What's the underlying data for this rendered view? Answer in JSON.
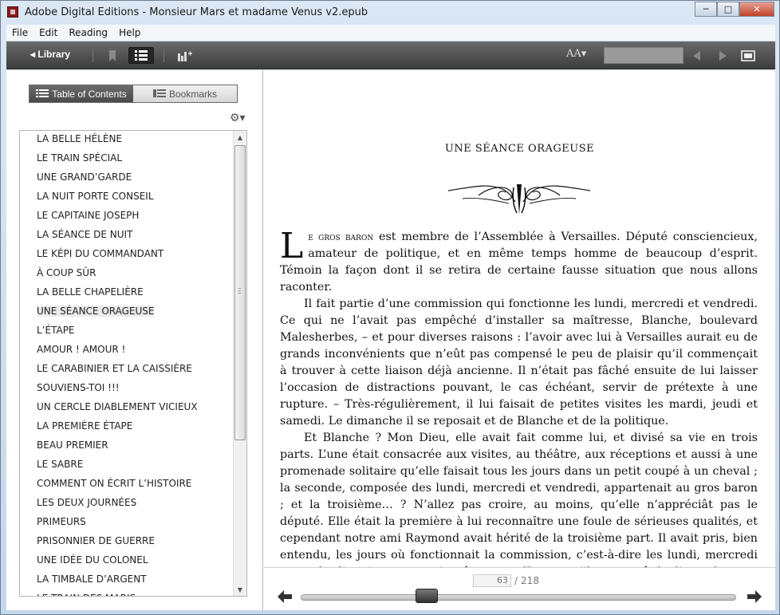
{
  "window": {
    "title": "Adobe Digital Editions - Monsieur Mars et madame Venus v2.epub",
    "minimize": "─",
    "maximize": "□",
    "close": "✕"
  },
  "menu": [
    {
      "label": "File"
    },
    {
      "label": "Edit"
    },
    {
      "label": "Reading"
    },
    {
      "label": "Help"
    }
  ],
  "toolbar": {
    "library_label": "◂ Library",
    "font_size_label": "AA▾"
  },
  "tabs": {
    "toc": "Table of Contents",
    "bookmarks": "Bookmarks"
  },
  "toc": {
    "items": [
      "LA BELLE HÉLÈNE",
      "LE TRAIN SPÉCIAL",
      "UNE GRAND’GARDE",
      "LA NUIT PORTE CONSEIL",
      "LE CAPITAINE JOSEPH",
      "LA SÉANCE DE NUIT",
      "LE KÉPI DU COMMANDANT",
      "À COUP SÛR",
      "LA BELLE CHAPELIÈRE",
      "UNE SÉANCE ORAGEUSE",
      "L’ÉTAPE",
      "AMOUR ! AMOUR !",
      "LE CARABINIER ET LA CAISSIÈRE",
      "SOUVIENS-TOI !!!",
      "UN CERCLE DIABLEMENT VICIEUX",
      "LA PREMIÈRE ÉTAPE",
      "BEAU PREMIER",
      "LE SABRE",
      "COMMENT ON ÉCRIT L’HISTOIRE",
      "LES DEUX JOURNÉES",
      "PRIMEURS",
      "PRISONNIER DE GUERRE",
      "UNE IDÉE DU COLONEL",
      "LA TIMBALE D’ARGENT",
      "LE TRAIN DES MARIS"
    ],
    "current_index": 9
  },
  "reader": {
    "chapter_title": "UNE SÉANCE ORAGEUSE",
    "dropcap": "L",
    "smallcaps_lead": "e gros baron",
    "p1_rest": " est membre de l’Assemblée à Versailles. Député consciencieux, amateur de politique, et en même temps homme de beaucoup d’esprit. Témoin la façon dont il se retira de certaine fausse situation que nous allons raconter.",
    "p2": "Il fait partie d’une commission qui fonctionne les lundi, mercredi et vendredi. Ce qui ne l’avait pas empêché d’installer sa maîtresse, Blanche, boulevard Malesherbes, – et pour diverses raisons : l’avoir avec lui à Versailles aurait eu de grands inconvénients que n’eût pas compensé le peu de plaisir qu’il commençait à trouver à cette liaison déjà ancienne. Il n’était pas fâché ensuite de lui laisser l’occasion de distractions pouvant, le cas échéant, servir de prétexte à une rupture. – Très-régulièrement, il lui faisait de petites visites les mardi, jeudi et samedi. Le dimanche il se reposait et de Blanche et de la politique.",
    "p3": "Et Blanche ? Mon Dieu, elle avait fait comme lui, et divisé sa vie en trois parts. L’une était consacrée aux visites, au théâtre, aux réceptions et aussi à une promenade solitaire qu’elle faisait tous les jours dans un petit coupé à un cheval ; la seconde, composée des lundi, mercredi et vendredi, appartenait au gros baron ; et la troisième… ? N’allez pas croire, au moins, qu’elle n’appréciât pas le député. Elle était la première à lui reconnaître une foule de sérieuses qualités, et cependant notre ami Raymond avait hérité de la troisième part. Il avait pris, bien entendu, les jours où fonctionnait la commission, c’est-à-dire les lundi, mercredi et vendredi, et je ne pourrais même pas affirmer qu’il se reposât le dimanche."
  },
  "pager": {
    "current_page": "63",
    "separator": "/",
    "total_pages": "218",
    "progress": 0.29
  },
  "icons": {
    "prev": "◀",
    "next": "▶",
    "back": "🡄",
    "forward": "🡆"
  }
}
